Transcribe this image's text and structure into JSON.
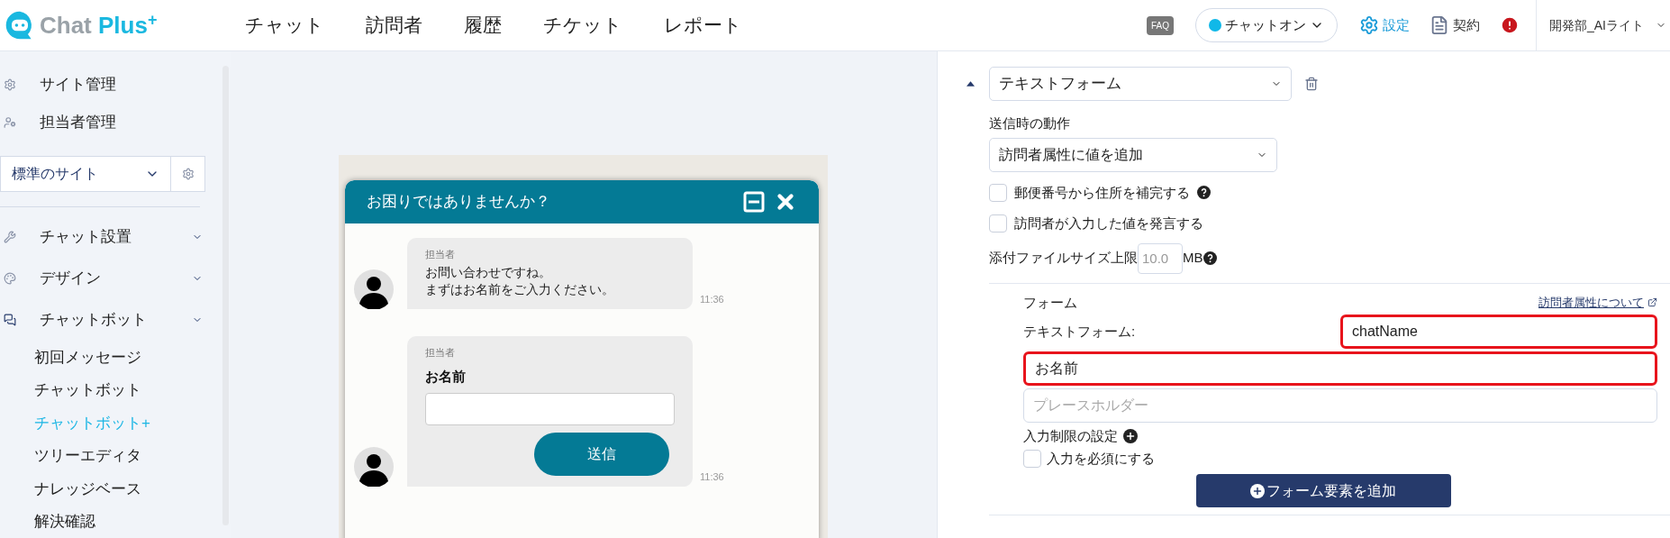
{
  "header": {
    "logo": {
      "name": "Chat Plus",
      "superscript": "+"
    },
    "nav": [
      {
        "label": "チャット"
      },
      {
        "label": "訪問者"
      },
      {
        "label": "履歴"
      },
      {
        "label": "チケット"
      },
      {
        "label": "レポート"
      }
    ],
    "faq": "FAQ",
    "status": {
      "label": "チャットオン",
      "on": true
    },
    "settings": "設定",
    "contract": "契約",
    "user": "開発部_AIライト"
  },
  "sidebar": {
    "top_items": [
      {
        "label": "サイト管理"
      },
      {
        "label": "担当者管理"
      }
    ],
    "site_select": "標準のサイト",
    "sections": [
      {
        "label": "チャット設置"
      },
      {
        "label": "デザイン"
      },
      {
        "label": "チャットボット",
        "children": [
          {
            "label": "初回メッセージ",
            "selected": false
          },
          {
            "label": "チャットボット",
            "selected": false
          },
          {
            "label": "チャットボット+",
            "selected": true
          },
          {
            "label": "ツリーエディタ",
            "selected": false
          },
          {
            "label": "ナレッジベース",
            "selected": false
          },
          {
            "label": "解決確認",
            "selected": false
          }
        ]
      }
    ]
  },
  "preview": {
    "title": "お困りではありませんか？",
    "messages": [
      {
        "kind": "text",
        "sender": "担当者",
        "lines": [
          "お問い合わせですね。",
          "まずはお名前をご入力ください。"
        ],
        "time": "11:36"
      },
      {
        "kind": "form",
        "sender": "担当者",
        "label": "お名前",
        "button": "送信",
        "time": "11:36"
      }
    ]
  },
  "editor": {
    "expanded": true,
    "element_type": "テキストフォーム",
    "action_label": "送信時の動作",
    "action": "訪問者属性に値を追加",
    "options": [
      {
        "label": "郵便番号から住所を補完する",
        "checked": false,
        "help": true
      },
      {
        "label": "訪問者が入力した値を発言する",
        "checked": false,
        "help": false
      }
    ],
    "file_size": {
      "label": "添付ファイルサイズ上限",
      "placeholder": "10.0",
      "unit": "MB"
    },
    "form": {
      "title": "フォーム",
      "link": "訪問者属性について",
      "field_label": "テキストフォーム:",
      "attribute": {
        "value": "chatName",
        "highlighted": true
      },
      "label_field": {
        "value": "お名前",
        "highlighted": true
      },
      "placeholder_field": {
        "placeholder": "プレースホルダー",
        "highlighted": false
      },
      "restriction": "入力制限の設定",
      "required": {
        "label": "入力を必須にする",
        "checked": false
      },
      "add_button": "フォーム要素を追加"
    }
  }
}
